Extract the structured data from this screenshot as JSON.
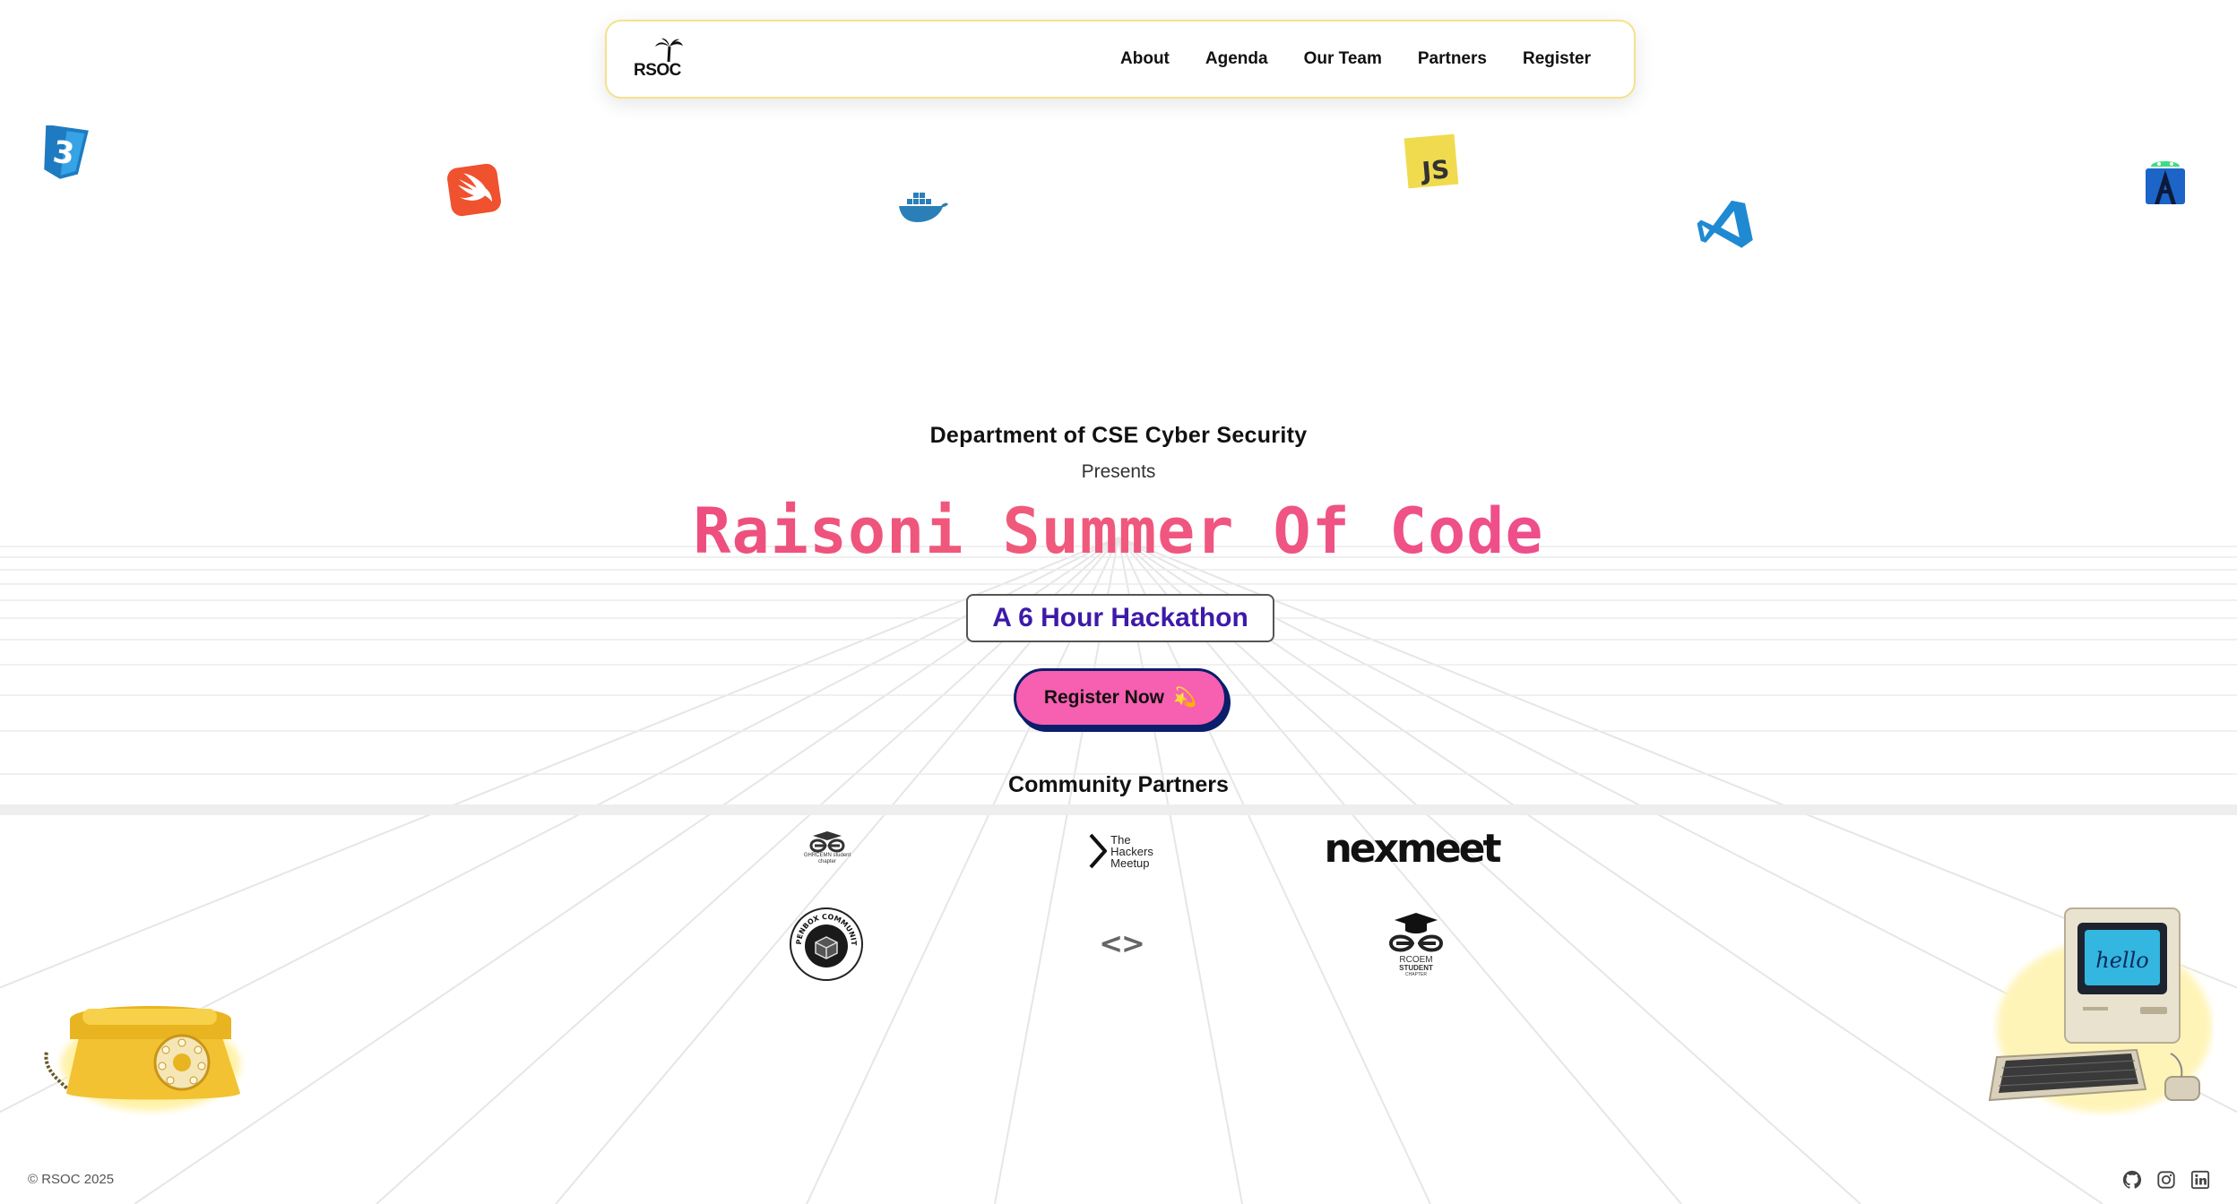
{
  "nav": {
    "logo_text": "RSOC",
    "links": [
      "About",
      "Agenda",
      "Our Team",
      "Partners",
      "Register"
    ]
  },
  "floating_icons": [
    "css3-icon",
    "swift-icon",
    "docker-icon",
    "javascript-icon",
    "vscode-icon",
    "android-studio-icon"
  ],
  "hero": {
    "department": "Department of CSE Cyber Security",
    "presents": "Presents",
    "title": "Raisoni Summer Of Code",
    "subtitle": "A 6 Hour Hackathon",
    "cta_label": "Register Now",
    "cta_emoji": "💫"
  },
  "partners": {
    "heading": "Community Partners",
    "logos": [
      {
        "name": "GHRCEMN student chapter",
        "icon": "gfg-icon"
      },
      {
        "name": "The Hackers Meetup Nagpur",
        "text": [
          "The",
          "Hackers",
          "Meetup"
        ]
      },
      {
        "name": "nexmeet",
        "text": "nexmeet"
      },
      {
        "name": "Openbox Community",
        "text": "OPENBOX COMMUNITY"
      },
      {
        "name": "code brackets",
        "text": "<>"
      },
      {
        "name": "RCOEM Student Chapter",
        "text": [
          "RCOEM",
          "STUDENT",
          "CHAPTER"
        ]
      }
    ]
  },
  "footer": {
    "copyright": "© RSOC 2025",
    "social_icons": [
      "github-icon",
      "instagram-icon",
      "linkedin-icon"
    ]
  },
  "colors": {
    "title_gradient_start": "#e8348a",
    "title_gradient_end": "#ec3fa0",
    "subtitle_text": "#3d1aa8",
    "cta_bg": "#f75fb0",
    "cta_border": "#0b1e6b",
    "nav_border": "#f4e28a"
  }
}
